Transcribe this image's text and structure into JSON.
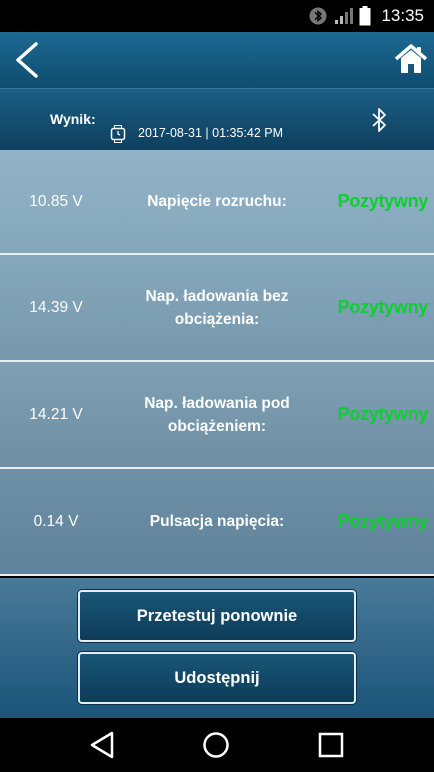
{
  "status_bar": {
    "time": "13:35",
    "icons": [
      "bluetooth-icon",
      "signal-icon",
      "battery-icon"
    ]
  },
  "app_bar": {
    "back_icon": "chevron-left-icon",
    "home_icon": "home-icon"
  },
  "result": {
    "label": "Wynik:",
    "date": "2017-08-31 | 01:35:42 PM",
    "clock_icon": "watch-icon",
    "bluetooth_icon": "bluetooth-icon"
  },
  "rows": [
    {
      "value": "10.85 V",
      "label": "Napięcie rozruchu:",
      "status": "Pozytywny"
    },
    {
      "value": "14.39 V",
      "label": "Nap. ładowania bez obciążenia:",
      "status": "Pozytywny"
    },
    {
      "value": "14.21 V",
      "label": "Nap. ładowania pod obciążeniem:",
      "status": "Pozytywny"
    },
    {
      "value": "0.14 V",
      "label": "Pulsacja napięcia:",
      "status": "Pozytywny"
    }
  ],
  "actions": {
    "retest_label": "Przetestuj ponownie",
    "share_label": "Udostępnij"
  },
  "colors": {
    "status_positive": "#0dcf2f",
    "header_blue": "#0f4c6e"
  },
  "nav_bar": {
    "icons": [
      "back-triangle-icon",
      "home-circle-icon",
      "recents-square-icon"
    ]
  }
}
